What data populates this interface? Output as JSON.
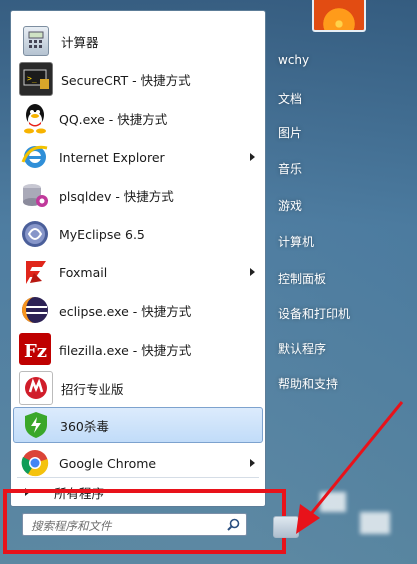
{
  "start_menu": {
    "apps": [
      {
        "label": "计算器",
        "icon": "calculator-icon",
        "has_submenu": false
      },
      {
        "label": "SecureCRT - 快捷方式",
        "icon": "securecrt-icon",
        "has_submenu": false
      },
      {
        "label": "QQ.exe - 快捷方式",
        "icon": "qq-icon",
        "has_submenu": false
      },
      {
        "label": "Internet Explorer",
        "icon": "internet-explorer-icon",
        "has_submenu": true
      },
      {
        "label": "plsqldev - 快捷方式",
        "icon": "plsqldev-icon",
        "has_submenu": false
      },
      {
        "label": "MyEclipse 6.5",
        "icon": "myeclipse-icon",
        "has_submenu": false
      },
      {
        "label": "Foxmail",
        "icon": "foxmail-icon",
        "has_submenu": true
      },
      {
        "label": "eclipse.exe - 快捷方式",
        "icon": "eclipse-icon",
        "has_submenu": false
      },
      {
        "label": "filezilla.exe - 快捷方式",
        "icon": "filezilla-icon",
        "has_submenu": false
      },
      {
        "label": "招行专业版",
        "icon": "cmb-icon",
        "has_submenu": false
      },
      {
        "label": "360杀毒",
        "icon": "360-antivirus-icon",
        "has_submenu": false,
        "selected": true
      },
      {
        "label": "Google Chrome",
        "icon": "chrome-icon",
        "has_submenu": true
      }
    ],
    "all_programs_label": "所有程序",
    "search": {
      "placeholder": "搜索程序和文件"
    },
    "right_items": [
      "wchy",
      "文档",
      "图片",
      "音乐",
      "游戏",
      "计算机",
      "控制面板",
      "设备和打印机",
      "默认程序",
      "帮助和支持"
    ],
    "colors": {
      "highlight_box": "#e8121a",
      "arrow": "#e8121a",
      "selected_bg": "#c1dcf9"
    }
  }
}
